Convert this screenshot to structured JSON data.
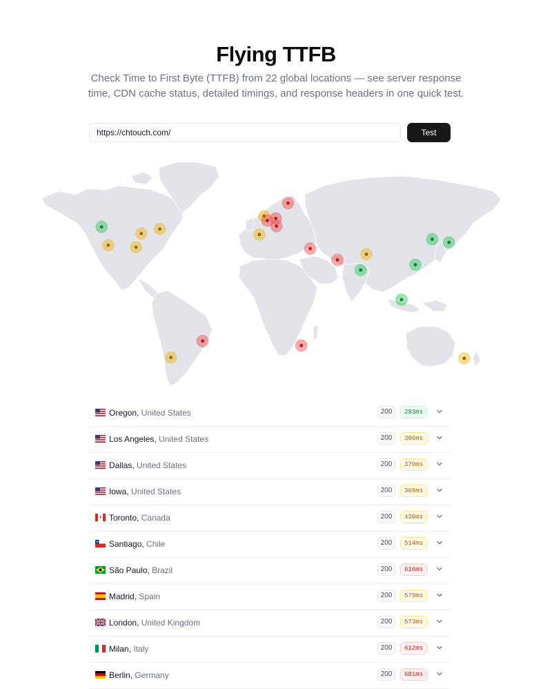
{
  "header": {
    "title": "Flying TTFB",
    "subtitle": "Check Time to First Byte (TTFB) from 22 global locations — see server response time, CDN cache status, detailed timings, and response headers in one quick test."
  },
  "form": {
    "url_value": "https://chtouch.com/",
    "button_label": "Test"
  },
  "colors": {
    "accent": "#18181b",
    "fast": "#22c55e",
    "medium": "#eab308",
    "slow": "#ef4444",
    "land": "#e3e4e9"
  },
  "map": {
    "markers": [
      {
        "name": "oregon",
        "lon": -123,
        "lat": 45,
        "level": "fast"
      },
      {
        "name": "los-angeles",
        "lon": -118,
        "lat": 34,
        "level": "medium"
      },
      {
        "name": "iowa",
        "lon": -93,
        "lat": 41,
        "level": "medium"
      },
      {
        "name": "dallas",
        "lon": -97,
        "lat": 32.8,
        "level": "medium"
      },
      {
        "name": "toronto",
        "lon": -79,
        "lat": 43.7,
        "level": "medium"
      },
      {
        "name": "santiago",
        "lon": -70.6,
        "lat": -33.4,
        "level": "medium"
      },
      {
        "name": "sao-paulo",
        "lon": -46.6,
        "lat": -23.5,
        "level": "slow"
      },
      {
        "name": "madrid",
        "lon": -3.7,
        "lat": 40.4,
        "level": "medium"
      },
      {
        "name": "london",
        "lon": -0.1,
        "lat": 51.5,
        "level": "medium"
      },
      {
        "name": "paris",
        "lon": 2.35,
        "lat": 48.8,
        "level": "slow"
      },
      {
        "name": "frankfurt",
        "lon": 8.7,
        "lat": 50.1,
        "level": "slow"
      },
      {
        "name": "milan",
        "lon": 9.2,
        "lat": 45.5,
        "level": "slow"
      },
      {
        "name": "stockholm",
        "lon": 18,
        "lat": 59.3,
        "level": "slow"
      },
      {
        "name": "tel-aviv",
        "lon": 34.8,
        "lat": 32,
        "level": "slow"
      },
      {
        "name": "dubai",
        "lon": 55.3,
        "lat": 25.2,
        "level": "slow"
      },
      {
        "name": "delhi",
        "lon": 77.2,
        "lat": 28.6,
        "level": "medium"
      },
      {
        "name": "mumbai",
        "lon": 72.9,
        "lat": 19.1,
        "level": "fast"
      },
      {
        "name": "singapore",
        "lon": 103.8,
        "lat": 1.35,
        "level": "fast"
      },
      {
        "name": "hong-kong",
        "lon": 114.2,
        "lat": 22.3,
        "level": "fast"
      },
      {
        "name": "seoul",
        "lon": 127,
        "lat": 37.6,
        "level": "fast"
      },
      {
        "name": "tokyo",
        "lon": 139.7,
        "lat": 35.7,
        "level": "fast"
      },
      {
        "name": "johannesburg",
        "lon": 28,
        "lat": -26.2,
        "level": "slow"
      },
      {
        "name": "sydney",
        "lon": 151.2,
        "lat": -33.9,
        "level": "medium"
      }
    ]
  },
  "results": [
    {
      "city": "Oregon",
      "country": "United States",
      "flag": "us",
      "status": "200",
      "ttfb": "293ms",
      "level": "fast"
    },
    {
      "city": "Los Angeles",
      "country": "United States",
      "flag": "us",
      "status": "200",
      "ttfb": "306ms",
      "level": "medium"
    },
    {
      "city": "Dallas",
      "country": "United States",
      "flag": "us",
      "status": "200",
      "ttfb": "370ms",
      "level": "medium"
    },
    {
      "city": "Iowa",
      "country": "United States",
      "flag": "us",
      "status": "200",
      "ttfb": "368ms",
      "level": "medium"
    },
    {
      "city": "Toronto",
      "country": "Canada",
      "flag": "ca",
      "status": "200",
      "ttfb": "430ms",
      "level": "medium"
    },
    {
      "city": "Santiago",
      "country": "Chile",
      "flag": "cl",
      "status": "200",
      "ttfb": "514ms",
      "level": "medium"
    },
    {
      "city": "São Paulo",
      "country": "Brazil",
      "flag": "br",
      "status": "200",
      "ttfb": "616ms",
      "level": "slow"
    },
    {
      "city": "Madrid",
      "country": "Spain",
      "flag": "es",
      "status": "200",
      "ttfb": "579ms",
      "level": "medium"
    },
    {
      "city": "London",
      "country": "United Kingdom",
      "flag": "gb",
      "status": "200",
      "ttfb": "573ms",
      "level": "medium"
    },
    {
      "city": "Milan",
      "country": "Italy",
      "flag": "it",
      "status": "200",
      "ttfb": "612ms",
      "level": "slow"
    },
    {
      "city": "Berlin",
      "country": "Germany",
      "flag": "de",
      "status": "200",
      "ttfb": "601ms",
      "level": "slow"
    }
  ]
}
